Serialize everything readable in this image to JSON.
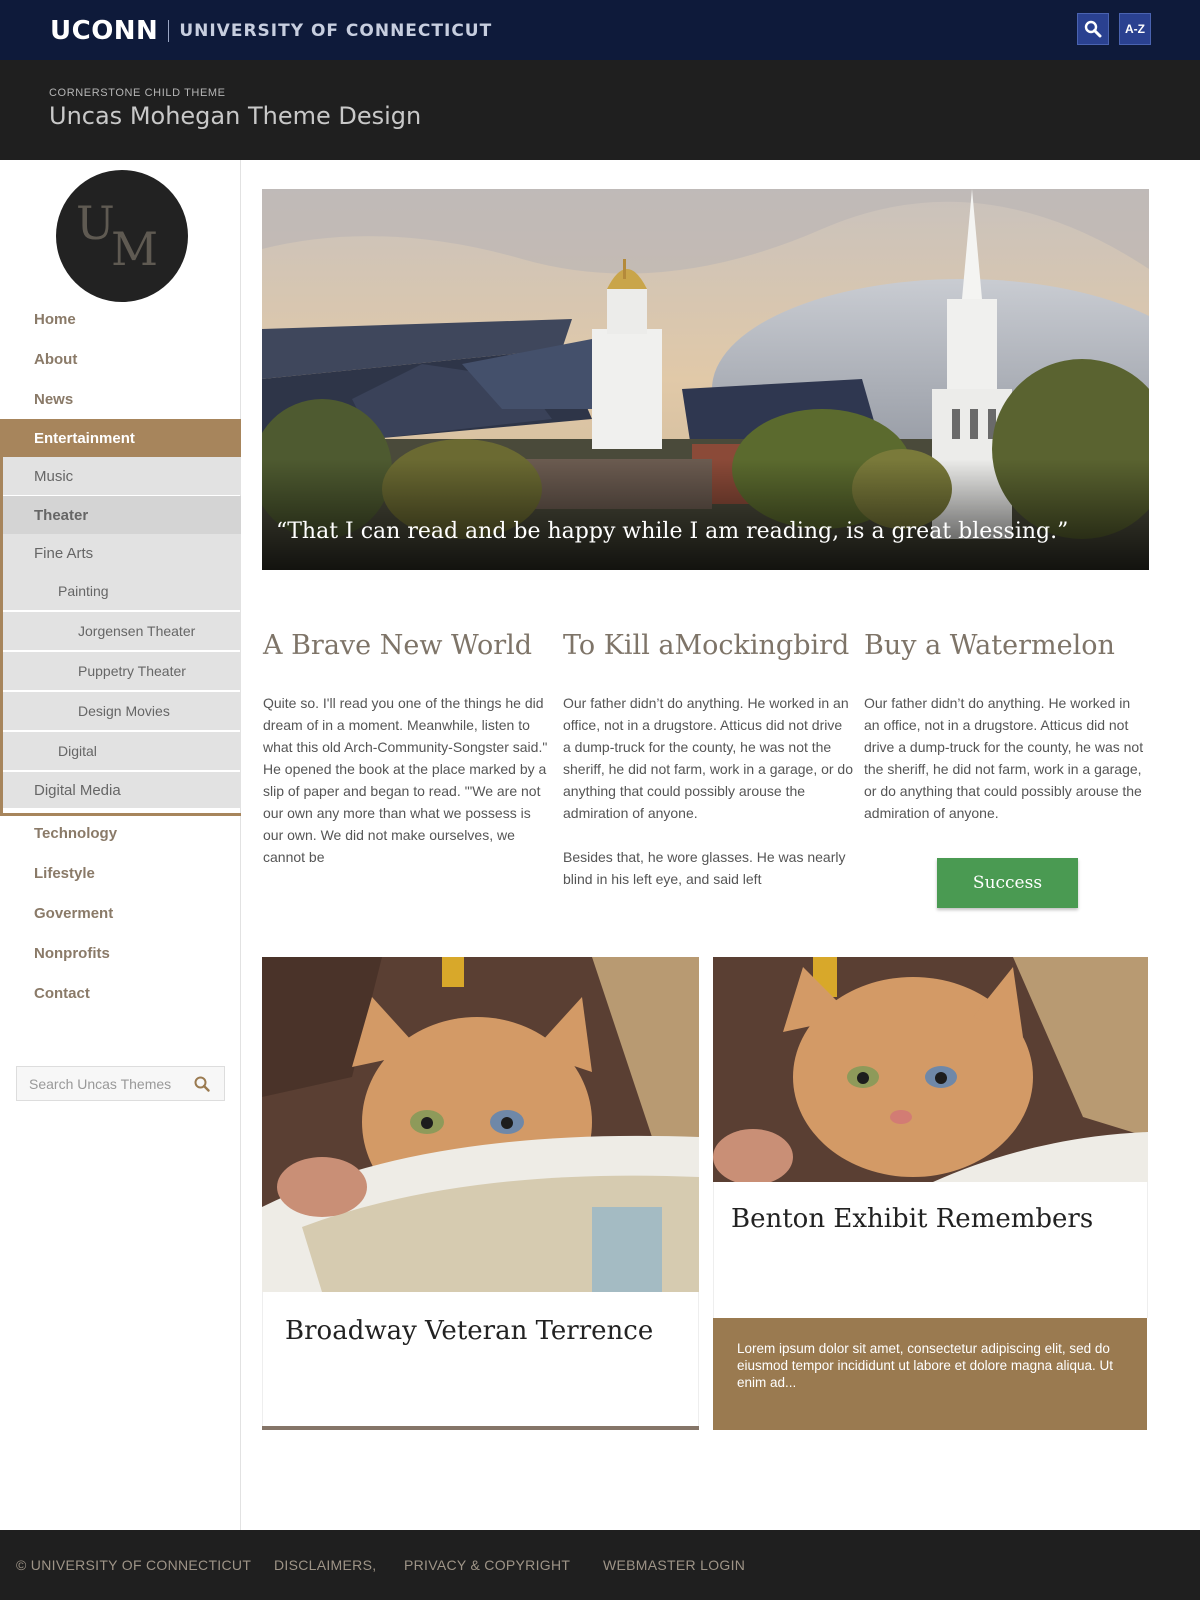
{
  "topbar": {
    "logo_text": "UCONN",
    "university": "UNIVERSITY OF CONNECTICUT",
    "az_label": "A-Z"
  },
  "header": {
    "kicker": "CORNERSTONE CHILD THEME",
    "title": "Uncas Mohegan Theme Design"
  },
  "logo": {
    "u": "U",
    "m": "M"
  },
  "nav": {
    "home": "Home",
    "about": "About",
    "news": "News",
    "entertainment": "Entertainment",
    "music": "Music",
    "theater": "Theater",
    "fine_arts": "Fine Arts",
    "painting": "Painting",
    "jorgensen": "Jorgensen Theater",
    "puppetry": "Puppetry Theater",
    "design_movies": "Design Movies",
    "digital": "Digital",
    "digital_media": "Digital Media",
    "technology": "Technology",
    "lifestyle": "Lifestyle",
    "government": "Goverment",
    "nonprofits": "Nonprofits",
    "contact": "Contact"
  },
  "search": {
    "placeholder": "Search Uncas Themes"
  },
  "hero": {
    "quote": "“That I can read and be happy while I am reading, is a great blessing.”"
  },
  "columns": [
    {
      "title": "A Brave New World",
      "body": "Quite so. I'll read you one of the things he did dream of in a moment. Meanwhile, listen to what this old Arch-Community-Songster said.\" He opened the book at the place marked by a slip of paper and began to read. '\"We are not our own any more than what we possess is our own. We did not make ourselves, we cannot be"
    },
    {
      "title": "To Kill aMockingbird",
      "body": "Our father didn’t do anything. He worked in an office, not in a drugstore. Atticus did not drive a dump-truck for the county, he was not the sheriff, he did not farm, work in a garage, or do anything that could possibly arouse the admiration of anyone.",
      "body2": "Besides that, he wore glasses. He was nearly blind in his left eye, and said left"
    },
    {
      "title": "Buy a Watermelon",
      "body": "Our father didn’t do anything. He worked in an office, not in a drugstore. Atticus did not drive a dump-truck for the county, he was not the sheriff, he did not farm, work in a garage, or do anything that could possibly arouse the admiration of anyone.",
      "button": "Success"
    }
  ],
  "cards": [
    {
      "title": "Broadway Veteran Terrence"
    },
    {
      "title": "Benton Exhibit Remembers",
      "excerpt": "Lorem ipsum dolor sit amet, consectetur adipiscing elit, sed do eiusmod tempor incididunt ut labore et dolore magna aliqua. Ut enim ad..."
    }
  ],
  "footer": {
    "copyright": "© UNIVERSITY OF CONNECTICUT",
    "disclaimers": "DISCLAIMERS,",
    "privacy": "PRIVACY & COPYRIGHT",
    "webmaster": "WEBMASTER LOGIN"
  },
  "colors": {
    "topbar": "#0e1a3a",
    "header": "#1f1f1f",
    "accent": "#a7855c",
    "success": "#4a9a52",
    "card_overlay": "#9a7a50"
  },
  "icons": {
    "topbar_search": "search-icon",
    "sidebar_search": "search-icon"
  }
}
